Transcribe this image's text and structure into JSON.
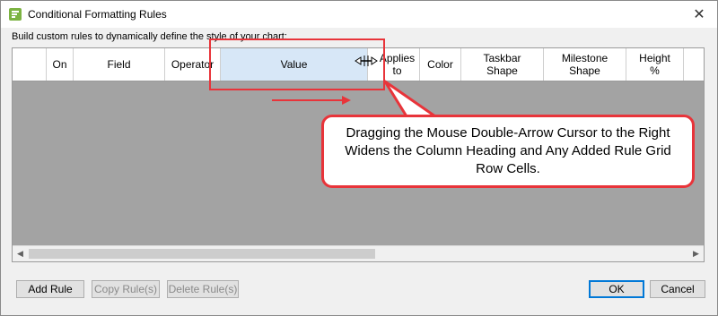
{
  "window": {
    "title": "Conditional Formatting Rules"
  },
  "subtitle": "Build custom rules to dynamically define the style of your chart:",
  "grid": {
    "columns": [
      {
        "id": "on",
        "label": "On"
      },
      {
        "id": "field",
        "label": "Field"
      },
      {
        "id": "operator",
        "label": "Operator"
      },
      {
        "id": "value",
        "label": "Value"
      },
      {
        "id": "applies-to",
        "label": "Applies to"
      },
      {
        "id": "color",
        "label": "Color"
      },
      {
        "id": "taskbar-shape",
        "label": "Taskbar Shape"
      },
      {
        "id": "milestone-shape",
        "label": "Milestone Shape"
      },
      {
        "id": "height",
        "label": "Height %"
      }
    ]
  },
  "buttons": {
    "add_rule": "Add Rule",
    "copy_rules": "Copy Rule(s)",
    "delete_rules": "Delete Rule(s)",
    "ok": "OK",
    "cancel": "Cancel"
  },
  "annotation": {
    "callout_text": "Dragging the Mouse Double-Arrow Cursor to the Right Widens the Column Heading and Any Added Rule Grid Row Cells."
  },
  "colors": {
    "annotation_red": "#e8343a",
    "selected_header": "#d7e7f7",
    "grid_empty": "#a3a3a3",
    "default_button_border": "#0078d7",
    "app_icon_green": "#7cb342"
  },
  "icons": {
    "app": "conditional-formatting-icon",
    "close": "close-icon",
    "resize": "resize-double-arrow-cursor-icon",
    "scroll_left": "chevron-left-icon",
    "scroll_right": "chevron-right-icon"
  }
}
